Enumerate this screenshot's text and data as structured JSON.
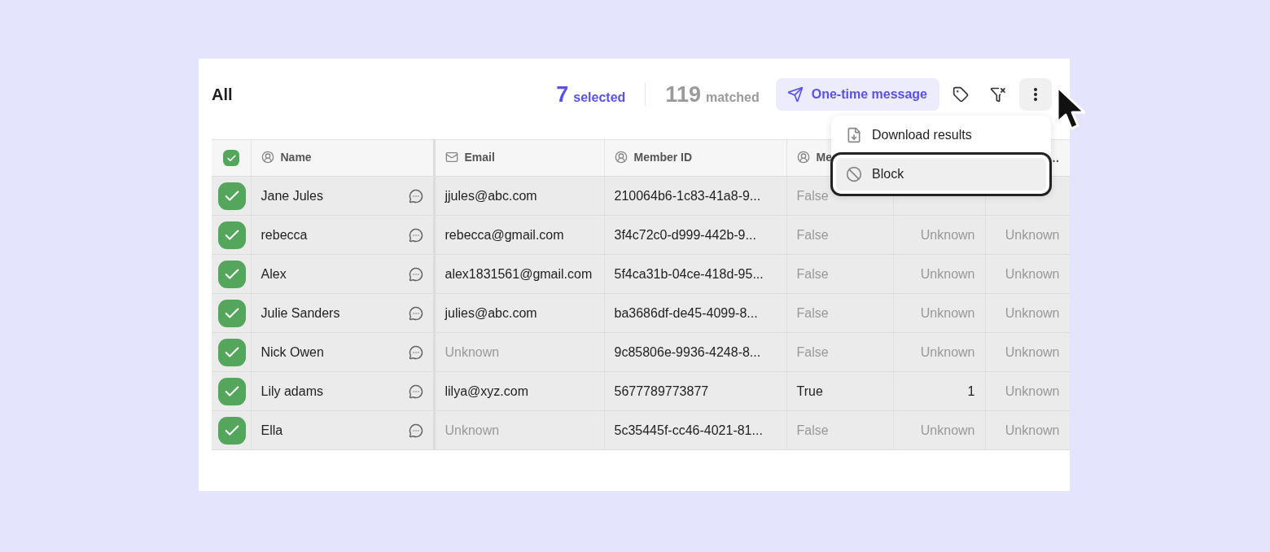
{
  "header": {
    "title": "All",
    "selected_count": "7",
    "selected_label": "selected",
    "matched_count": "119",
    "matched_label": "matched",
    "message_button": "One-time message"
  },
  "menu": {
    "open": true,
    "items": [
      {
        "label": "Download results",
        "selected": false
      },
      {
        "label": "Block",
        "selected": true
      }
    ]
  },
  "table": {
    "all_checked": true,
    "columns": [
      {
        "label": "Name"
      },
      {
        "label": "Email"
      },
      {
        "label": "Member ID"
      },
      {
        "label": "Me"
      },
      null,
      {
        "label": "…"
      }
    ],
    "rows": [
      {
        "checked": true,
        "cells": [
          {
            "text": "Jane Jules",
            "muted": false
          },
          {
            "text": "jjules@abc.com",
            "muted": false
          },
          {
            "text": "210064b6-1c83-41a8-9...",
            "muted": false
          },
          {
            "text": "False",
            "muted": true
          }
        ]
      },
      {
        "checked": true,
        "cells": [
          {
            "text": "rebecca",
            "muted": false
          },
          {
            "text": "rebecca@gmail.com",
            "muted": false
          },
          {
            "text": "3f4c72c0-d999-442b-9...",
            "muted": false
          },
          {
            "text": "False",
            "muted": true
          },
          {
            "text": "Unknown",
            "muted": true
          },
          {
            "text": "Unknown",
            "muted": true
          }
        ]
      },
      {
        "checked": true,
        "cells": [
          {
            "text": "Alex",
            "muted": false
          },
          {
            "text": "alex1831561@gmail.com",
            "muted": false
          },
          {
            "text": "5f4ca31b-04ce-418d-95...",
            "muted": false
          },
          {
            "text": "False",
            "muted": true
          },
          {
            "text": "Unknown",
            "muted": true
          },
          {
            "text": "Unknown",
            "muted": true
          }
        ]
      },
      {
        "checked": true,
        "cells": [
          {
            "text": "Julie Sanders",
            "muted": false
          },
          {
            "text": "julies@abc.com",
            "muted": false
          },
          {
            "text": "ba3686df-de45-4099-8...",
            "muted": false
          },
          {
            "text": "False",
            "muted": true
          },
          {
            "text": "Unknown",
            "muted": true
          },
          {
            "text": "Unknown",
            "muted": true
          }
        ]
      },
      {
        "checked": true,
        "cells": [
          {
            "text": "Nick Owen",
            "muted": false
          },
          {
            "text": "Unknown",
            "muted": true
          },
          {
            "text": "9c85806e-9936-4248-8...",
            "muted": false
          },
          {
            "text": "False",
            "muted": true
          },
          {
            "text": "Unknown",
            "muted": true
          },
          {
            "text": "Unknown",
            "muted": true
          }
        ]
      },
      {
        "checked": true,
        "cells": [
          {
            "text": "Lily adams",
            "muted": false
          },
          {
            "text": "lilya@xyz.com",
            "muted": false
          },
          {
            "text": "5677789773877",
            "muted": false
          },
          {
            "text": "True",
            "muted": false
          },
          {
            "text": "1",
            "muted": false
          },
          {
            "text": "Unknown",
            "muted": true
          }
        ]
      },
      {
        "checked": true,
        "cells": [
          {
            "text": "Ella",
            "muted": false
          },
          {
            "text": "Unknown",
            "muted": true
          },
          {
            "text": "5c35445f-cc46-4021-81...",
            "muted": false
          },
          {
            "text": "False",
            "muted": true
          },
          {
            "text": "Unknown",
            "muted": true
          },
          {
            "text": "Unknown",
            "muted": true
          }
        ]
      }
    ]
  }
}
